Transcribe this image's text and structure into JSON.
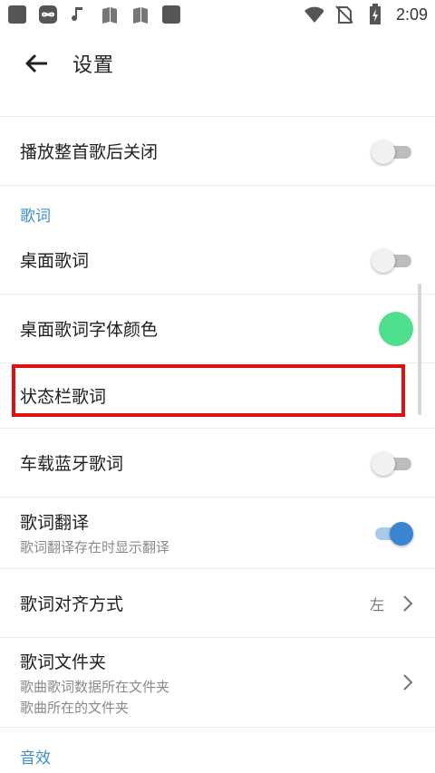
{
  "status_bar": {
    "time": "2:09",
    "icons": [
      "app-square-icon",
      "infinity-icon",
      "music-note-icon",
      "book-icon",
      "book-icon",
      "app-square-icon",
      "wifi-icon",
      "no-sim-icon",
      "battery-charging-icon"
    ]
  },
  "app_bar": {
    "title": "设置",
    "back_icon": "arrow-left-icon"
  },
  "items": {
    "close_after_song": {
      "label": "播放整首歌后关闭",
      "toggle": false
    },
    "lyrics_section": "歌词",
    "desktop_lyrics": {
      "label": "桌面歌词",
      "toggle": false
    },
    "desktop_lyrics_color": {
      "label": "桌面歌词字体颜色",
      "color": "#4ee08e"
    },
    "status_bar_lyrics": {
      "label": "状态栏歌词"
    },
    "car_bluetooth_lyrics": {
      "label": "车载蓝牙歌词",
      "toggle": false
    },
    "lyrics_translation": {
      "label": "歌词翻译",
      "sub": "歌词翻译存在时显示翻译",
      "toggle": true
    },
    "lyrics_alignment": {
      "label": "歌词对齐方式",
      "value": "左"
    },
    "lyrics_folder": {
      "label": "歌词文件夹",
      "sub1": "歌曲歌词数据所在文件夹",
      "sub2": "歌曲所在的文件夹"
    },
    "audio_section": "音效"
  },
  "colors": {
    "accent": "#3d8fd1",
    "highlight": "#e01010",
    "toggle_on": "#3a85d2"
  }
}
